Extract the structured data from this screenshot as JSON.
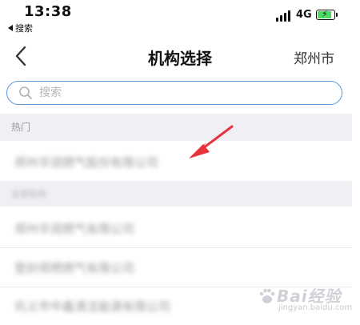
{
  "status_bar": {
    "time": "13:38",
    "back_app_label": "搜索",
    "network": "4G",
    "battery_level": 0.75,
    "battery_color": "#4cd964"
  },
  "nav": {
    "back_icon": "chevron-left-icon",
    "title": "机构选择",
    "city": "郑州市"
  },
  "search": {
    "placeholder": "搜索",
    "value": "",
    "icon": "search-icon",
    "border_color": "#5b9be0"
  },
  "sections": {
    "hot": {
      "label": "热门",
      "items": [
        {
          "label": "郑州华润燃气股份有限公司"
        }
      ]
    },
    "all": {
      "label": "全部机构",
      "items": [
        {
          "label": "郑州华润燃气有限公司"
        },
        {
          "label": "登封郑燃燃气有限公司"
        },
        {
          "label": "巩义市中鑫清洁能源有限公司"
        }
      ]
    }
  },
  "watermark": {
    "text": "Bai经验",
    "url": "jingyan.baidu.com"
  },
  "colors": {
    "annotation_arrow": "#e8323c",
    "section_background": "#efeff4"
  }
}
